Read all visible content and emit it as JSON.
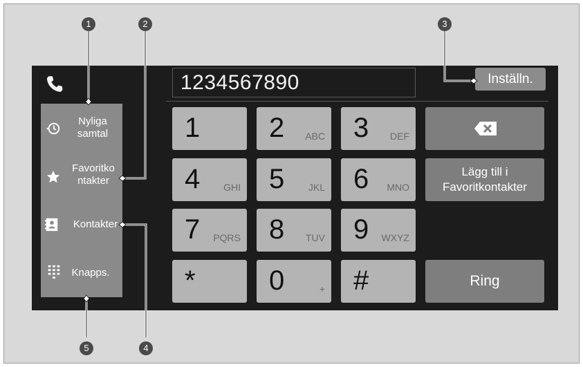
{
  "dialer": {
    "number": "1234567890",
    "settings_label": "Inställn.",
    "phone_icon": "phone-icon"
  },
  "sidebar": {
    "items": [
      {
        "line1": "Nyliga",
        "line2": "samtal",
        "icon": "history-icon"
      },
      {
        "line1": "Favoritko",
        "line2": "ntakter",
        "icon": "star-icon"
      },
      {
        "line1": "Kontakter",
        "line2": "",
        "icon": "contacts-icon"
      },
      {
        "line1": "Knapps.",
        "line2": "",
        "icon": "keypad-icon"
      }
    ]
  },
  "keypad": {
    "keys": [
      {
        "digit": "1",
        "letters": ""
      },
      {
        "digit": "2",
        "letters": "ABC"
      },
      {
        "digit": "3",
        "letters": "DEF"
      },
      {
        "digit": "4",
        "letters": "GHI"
      },
      {
        "digit": "5",
        "letters": "JKL"
      },
      {
        "digit": "6",
        "letters": "MNO"
      },
      {
        "digit": "7",
        "letters": "PQRS"
      },
      {
        "digit": "8",
        "letters": "TUV"
      },
      {
        "digit": "9",
        "letters": "WXYZ"
      },
      {
        "digit": "*",
        "letters": ""
      },
      {
        "digit": "0",
        "letters": "+"
      },
      {
        "digit": "#",
        "letters": ""
      }
    ],
    "backspace_icon": "backspace-icon",
    "add_favorite_line1": "Lägg till i",
    "add_favorite_line2": "Favoritkontakter",
    "call_label": "Ring"
  },
  "callouts": [
    "1",
    "2",
    "3",
    "4",
    "5"
  ],
  "colors": {
    "screen_bg": "#1c1c1c",
    "key_light": "#b4b4b4",
    "key_dark": "#7e7e7e",
    "sidebar_bg": "#8a8a8a",
    "page_bg": "#d9d9d9"
  }
}
